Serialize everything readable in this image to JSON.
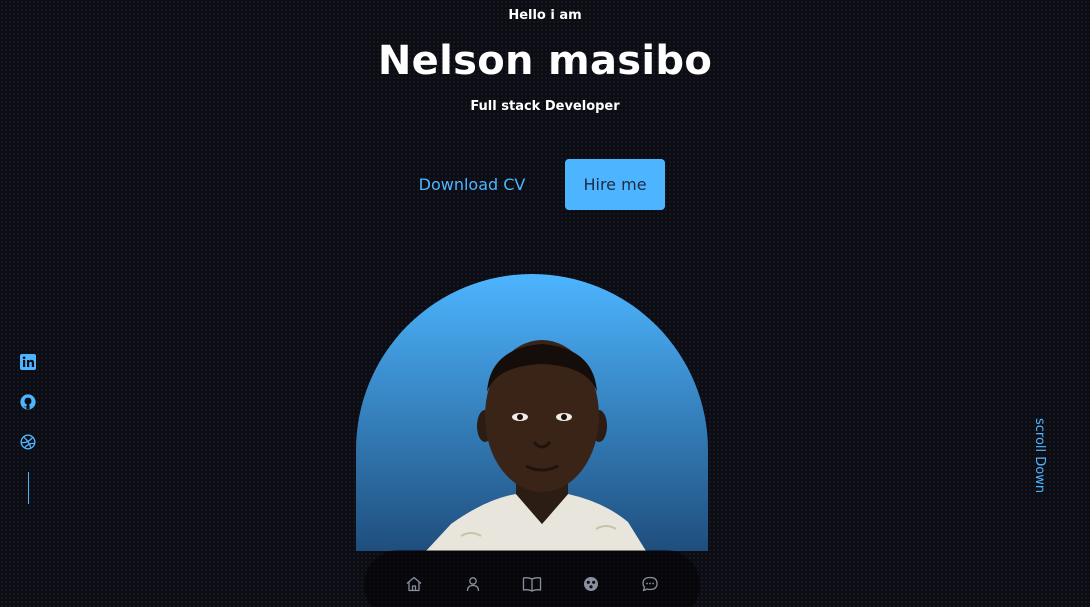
{
  "header": {
    "greeting": "Hello i am",
    "name": "Nelson masibo",
    "role": "Full stack Developer"
  },
  "cta": {
    "download_label": "Download CV",
    "hire_label": "Hire me"
  },
  "socials": [
    "linkedin-icon",
    "github-icon",
    "dribbble-icon"
  ],
  "scroll_label": "scroll Down",
  "nav": [
    "home-icon",
    "user-icon",
    "book-icon",
    "services-icon",
    "chat-icon"
  ],
  "colors": {
    "accent": "#4db5ff",
    "background": "#0b0c14",
    "button_text": "#1f2a44"
  }
}
